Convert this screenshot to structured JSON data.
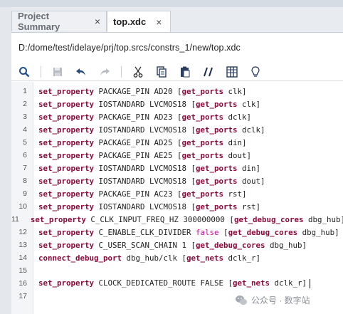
{
  "tabs": [
    {
      "label": "Project Summary",
      "close": "×",
      "active": false
    },
    {
      "label": "top.xdc",
      "close": "×",
      "active": true
    }
  ],
  "file_path": "D:/dome/test/idelaye/prj/top.srcs/constrs_1/new/top.xdc",
  "toolbar": {
    "icons": [
      "search-icon",
      "save-icon",
      "undo-icon",
      "redo-icon",
      "cut-icon",
      "copy-icon",
      "paste-icon",
      "comment-icon",
      "columns-icon",
      "lightbulb-icon"
    ]
  },
  "editor": {
    "lines": [
      {
        "n": "1",
        "kw": "set_property",
        "a": " PACKAGE_PIN AD20 [",
        "cmd": "get_ports",
        "b": " clk]"
      },
      {
        "n": "2",
        "kw": "set_property",
        "a": " IOSTANDARD LVCMOS18 [",
        "cmd": "get_ports",
        "b": " clk]"
      },
      {
        "n": "3",
        "kw": "set_property",
        "a": " PACKAGE_PIN AD23 [",
        "cmd": "get_ports",
        "b": " dclk]"
      },
      {
        "n": "4",
        "kw": "set_property",
        "a": " IOSTANDARD LVCMOS18 [",
        "cmd": "get_ports",
        "b": " dclk]"
      },
      {
        "n": "5",
        "kw": "set_property",
        "a": " PACKAGE_PIN AD25 [",
        "cmd": "get_ports",
        "b": " din]"
      },
      {
        "n": "6",
        "kw": "set_property",
        "a": " PACKAGE_PIN AE25 [",
        "cmd": "get_ports",
        "b": " dout]"
      },
      {
        "n": "7",
        "kw": "set_property",
        "a": " IOSTANDARD LVCMOS18 [",
        "cmd": "get_ports",
        "b": " din]"
      },
      {
        "n": "8",
        "kw": "set_property",
        "a": " IOSTANDARD LVCMOS18 [",
        "cmd": "get_ports",
        "b": " dout]"
      },
      {
        "n": "9",
        "kw": "set_property",
        "a": " PACKAGE_PIN AC23 [",
        "cmd": "get_ports",
        "b": " rst]"
      },
      {
        "n": "10",
        "kw": "set_property",
        "a": " IOSTANDARD LVCMOS18 [",
        "cmd": "get_ports",
        "b": " rst]"
      },
      {
        "n": "11",
        "kw": "set_property",
        "a": " C_CLK_INPUT_FREQ_HZ 300000000 [",
        "cmd": "get_debug_cores",
        "b": " dbg_hub]"
      },
      {
        "n": "12",
        "kw": "set_property",
        "a": " C_ENABLE_CLK_DIVIDER ",
        "f": "false",
        "a2": " [",
        "cmd": "get_debug_cores",
        "b": " dbg_hub]"
      },
      {
        "n": "13",
        "kw": "set_property",
        "a": " C_USER_SCAN_CHAIN 1 [",
        "cmd": "get_debug_cores",
        "b": " dbg_hub]"
      },
      {
        "n": "14",
        "kw": "connect_debug_port",
        "a": " dbg_hub/clk [",
        "cmd": "get_nets",
        "b": " dclk_r]"
      },
      {
        "n": "15"
      },
      {
        "n": "16",
        "kw": "set_property",
        "a": " CLOCK_DEDICATED_ROUTE FALSE [",
        "cmd": "get_nets",
        "b": " dclk_r]",
        "caret": true
      },
      {
        "n": "17"
      }
    ]
  },
  "watermark": {
    "text": "公众号 · 数字站",
    "icon": "wechat-icon"
  },
  "colors": {
    "keyword": "#8b0a3b",
    "false_literal": "#c0109a",
    "tabstrip": "#e8ebef"
  }
}
